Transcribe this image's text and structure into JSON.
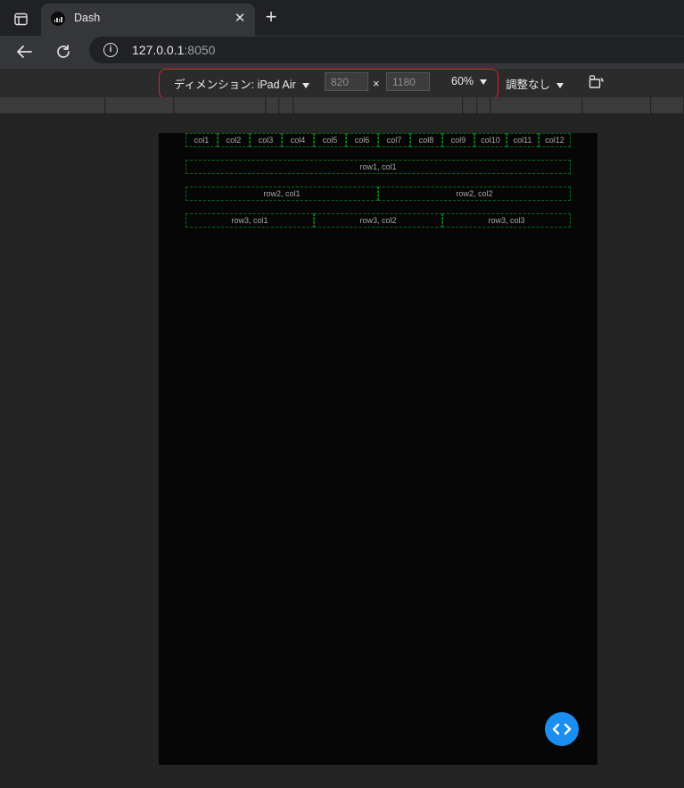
{
  "browser": {
    "tab": {
      "title": "Dash"
    },
    "address": {
      "host": "127.0.0.1",
      "port": ":8050"
    }
  },
  "devtools": {
    "dimension_label": "ディメンション: iPad Air",
    "width_value": "820",
    "times_symbol": "×",
    "height_value": "1180",
    "zoom": "60%",
    "throttling": "調整なし"
  },
  "page": {
    "header_cols": [
      "col1",
      "col2",
      "col3",
      "col4",
      "col5",
      "col6",
      "col7",
      "col8",
      "col9",
      "col10",
      "col11",
      "col12"
    ],
    "row1": [
      "row1, col1"
    ],
    "row2": [
      "row2, col1",
      "row2, col2"
    ],
    "row3": [
      "row3, col1",
      "row3, col2",
      "row3, col3"
    ]
  },
  "colors": {
    "highlight": "#e0202a",
    "grid_border": "#0c6a18",
    "fab": "#1b8ef2"
  }
}
